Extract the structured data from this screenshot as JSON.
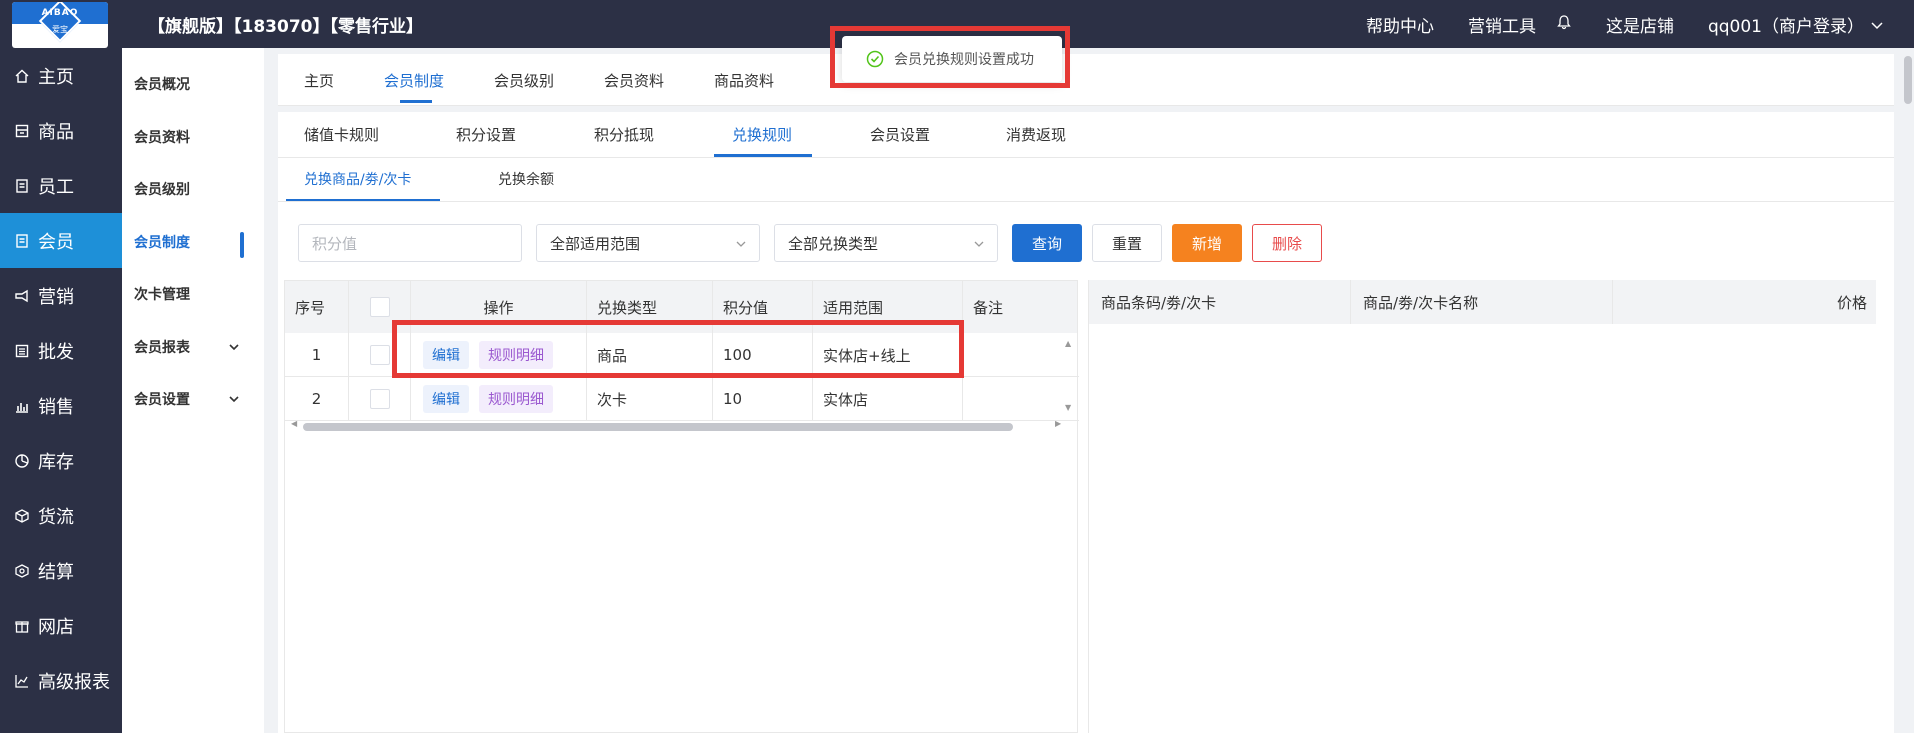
{
  "header": {
    "logo_text": "AIBAO",
    "logo_sub": "爱宝",
    "shop_title": "【旗舰版】【183070】【零售行业】",
    "links": [
      "帮助中心",
      "营销工具",
      "这是店铺"
    ],
    "user": "qq001（商户登录）"
  },
  "nav": {
    "items": [
      "主页",
      "商品",
      "员工",
      "会员",
      "营销",
      "批发",
      "销售",
      "库存",
      "货流",
      "结算",
      "网店",
      "高级报表"
    ],
    "active": "会员"
  },
  "subnav": {
    "items": [
      "会员概况",
      "会员资料",
      "会员级别",
      "会员制度",
      "次卡管理",
      "会员报表",
      "会员设置"
    ],
    "active": "会员制度"
  },
  "tabs1": [
    "主页",
    "会员制度",
    "会员级别",
    "会员资料",
    "商品资料"
  ],
  "tabs2": [
    "储值卡规则",
    "积分设置",
    "积分抵现",
    "兑换规则",
    "会员设置",
    "消费返现"
  ],
  "tabs3": [
    "兑换商品/劵/次卡",
    "兑换余额"
  ],
  "filters": {
    "points_placeholder": "积分值",
    "scope_select": "全部适用范围",
    "type_select": "全部兑换类型",
    "query": "查询",
    "reset": "重置",
    "add": "新增",
    "delete": "删除"
  },
  "table": {
    "headers": [
      "序号",
      "操作",
      "兑换类型",
      "积分值",
      "适用范围",
      "备注"
    ],
    "edit_label": "编辑",
    "rule_label": "规则明细",
    "rows": [
      {
        "no": "1",
        "type": "商品",
        "points": "100",
        "scope": "实体店+线上",
        "note": ""
      },
      {
        "no": "2",
        "type": "次卡",
        "points": "10",
        "scope": "实体店",
        "note": ""
      }
    ]
  },
  "detail_table": {
    "headers": [
      "商品条码/劵/次卡",
      "商品/劵/次卡名称",
      "价格"
    ]
  },
  "toast": {
    "message": "会员兑换规则设置成功"
  },
  "colors": {
    "primary": "#1f6fd1",
    "sidebar": "#2c3045",
    "add": "#f5821f",
    "danger": "#e84b4b",
    "highlight": "#e53935"
  }
}
